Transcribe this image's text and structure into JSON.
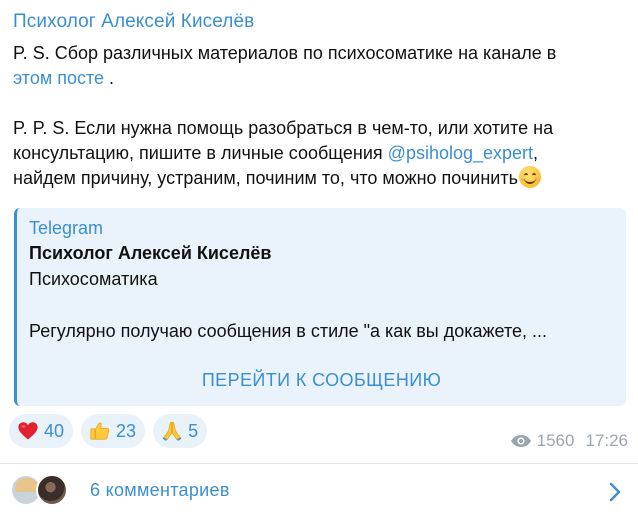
{
  "post": {
    "author": "Психолог Алексей Киселёв",
    "line1_text": "P. S. Сбор различных материалов по психосоматике на канале в",
    "line2_link": "этом посте",
    "line2_rest": " .",
    "line4": " P. P. S. Если нужна помощь разобраться в чем-то, или хотите на",
    "line5_text": "консультацию, пишите в личные сообщения ",
    "line5_mention": "@psiholog_expert",
    "line5_rest": ",",
    "line6_text": "найдем причину, устраним, починим то, что можно починить",
    "line6_emoji": "smiling-face-emoji"
  },
  "preview": {
    "site": "Telegram",
    "title": "Психолог Алексей Киселёв",
    "subtitle": "Психосоматика",
    "description": "Регулярно получаю сообщения в стиле \"а как вы докажете, ...",
    "button_label": "ПЕРЕЙТИ К СООБЩЕНИЮ"
  },
  "reactions": [
    {
      "emoji": "red-heart-icon",
      "count": "40"
    },
    {
      "emoji": "thumbs-up-icon",
      "count": "23"
    },
    {
      "emoji": "folded-hands-icon",
      "count": "5"
    }
  ],
  "meta": {
    "views_icon": "eye-icon",
    "views": "1560",
    "time": "17:26"
  },
  "comments": {
    "label": "6 комментариев",
    "chevron_icon": "chevron-right-icon"
  },
  "colors": {
    "accent": "#3a8fd0",
    "preview_bg": "#eaf3fb",
    "meta_gray": "#9aa5ae"
  }
}
